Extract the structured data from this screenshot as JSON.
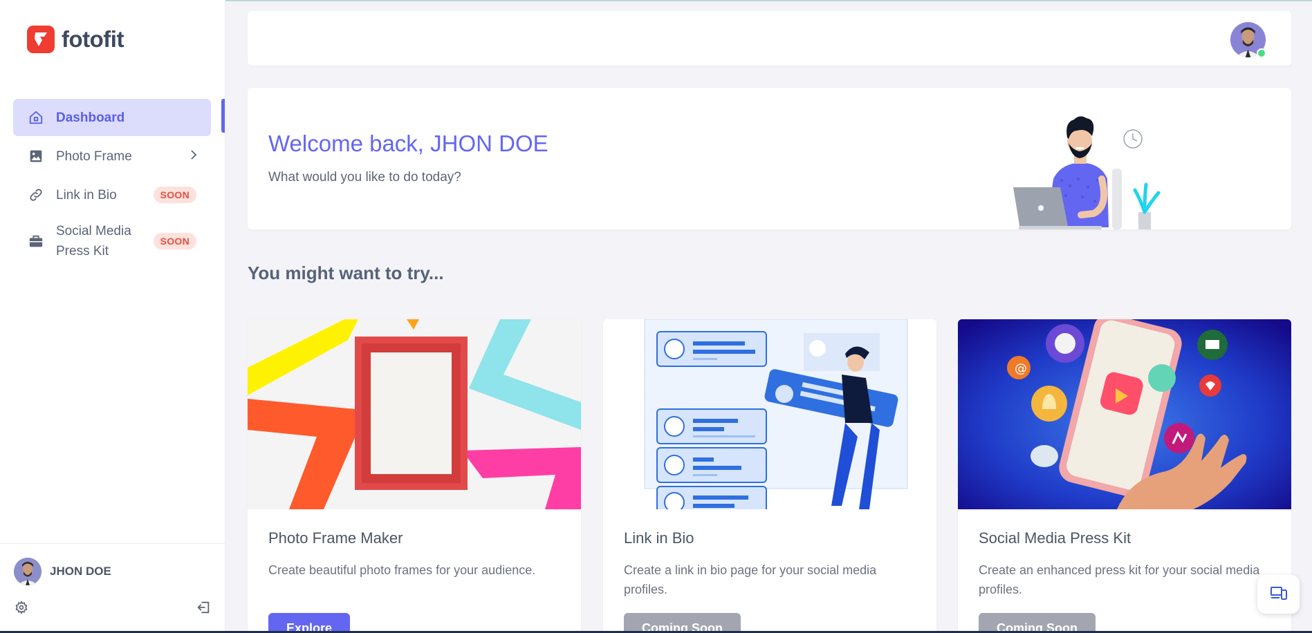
{
  "app": {
    "name": "fotofit"
  },
  "sidebar": {
    "items": [
      {
        "label": "Dashboard",
        "icon": "home-icon",
        "active": true
      },
      {
        "label": "Photo Frame",
        "icon": "image-icon",
        "has_submenu": true
      },
      {
        "label": "Link in Bio",
        "icon": "link-icon",
        "badge": "SOON"
      },
      {
        "label": "Social Media Press Kit",
        "icon": "briefcase-icon",
        "badge": "SOON"
      }
    ],
    "footer": {
      "user_name": "JHON DOE",
      "settings_icon": "gear-icon",
      "logout_icon": "logout-icon"
    }
  },
  "header": {
    "avatar_icon": "user-avatar",
    "status": "online"
  },
  "welcome": {
    "title": "Welcome back, JHON DOE",
    "subtitle": "What would you like to do today?"
  },
  "section": {
    "title": "You might want to try..."
  },
  "cards": [
    {
      "title": "Photo Frame Maker",
      "description": "Create beautiful photo frames for your audience.",
      "button": "Explore",
      "enabled": true
    },
    {
      "title": "Link in Bio",
      "description": "Create a link in bio page for your social media profiles.",
      "button": "Coming Soon",
      "enabled": false
    },
    {
      "title": "Social Media Press Kit",
      "description": "Create an enhanced press kit for your social media profiles.",
      "button": "Coming Soon",
      "enabled": false
    }
  ],
  "colors": {
    "accent": "#6366f1",
    "brand": "#ef3d33",
    "badge_bg": "#fde1dd",
    "badge_text": "#e7503f"
  }
}
